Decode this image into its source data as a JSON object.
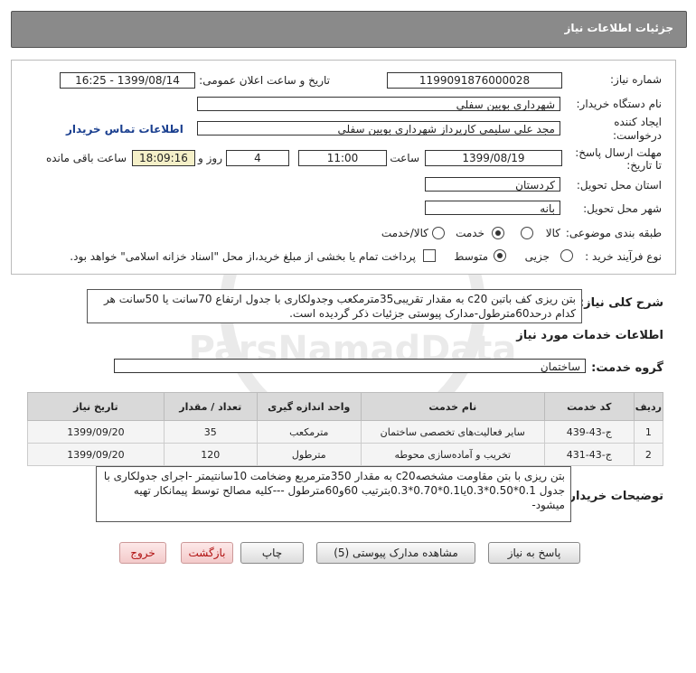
{
  "header": {
    "title": "جزئیات اطلاعات نیاز"
  },
  "fields": {
    "need_number_label": "شماره نیاز:",
    "need_number": "1199091876000028",
    "announce_label": "تاریخ و ساعت اعلان عمومی:",
    "announce_value": "1399/08/14 - 16:25",
    "buyer_org_label": "نام دستگاه خریدار:",
    "buyer_org": "شهرداری بویین سفلی",
    "creator_label_1": "ایجاد کننده",
    "creator_label_2": "درخواست:",
    "creator": "مجد علی سلیمی کارپرداز شهرداری بویین سفلی",
    "contact_link": "اطلاعات تماس خریدار",
    "deadline_label_1": "مهلت ارسال پاسخ:",
    "deadline_label_2": "تا تاریخ:",
    "deadline_date": "1399/08/19",
    "time_label": "ساعت",
    "deadline_time": "11:00",
    "days_value": "4",
    "days_label": "روز و",
    "remaining_time": "18:09:16",
    "remaining_label": "ساعت باقی مانده",
    "province_label": "استان محل تحویل:",
    "province": "کردستان",
    "city_label": "شهر محل تحویل:",
    "city": "بانه",
    "category_label": "طبقه بندی موضوعی:",
    "category_options": [
      "کالا",
      "خدمت",
      "کالا/خدمت"
    ],
    "process_label": "نوع فرآیند خرید :",
    "process_options": [
      "جزیی",
      "متوسط"
    ],
    "payment_note": "پرداخت تمام یا بخشی از مبلغ خرید،از محل \"اسناد خزانه اسلامی\" خواهد بود."
  },
  "summary": {
    "label": "شرح کلی نیاز:",
    "text": "بتن ریزی کف باتبن c20 به مقدار تقریبی35مترمکعب وجدولکاری با جدول ارتفاع 70سانت یا 50سانت هر کدام درحد60مترطول-مدارک پیوستی جزئیات ذکر گردیده است."
  },
  "services": {
    "section_title": "اطلاعات خدمات مورد نیاز",
    "group_label": "گروه خدمت:",
    "group_value": "ساختمان",
    "columns": [
      "ردیف",
      "کد خدمت",
      "نام خدمت",
      "واحد اندازه گیری",
      "تعداد / مقدار",
      "تاریخ نیاز"
    ],
    "rows": [
      [
        "1",
        "ج-43-439",
        "سایر فعالیت‌های تخصصی ساختمان",
        "مترمکعب",
        "35",
        "1399/09/20"
      ],
      [
        "2",
        "ج-43-431",
        "تخریب و آماده‌سازی محوطه",
        "مترطول",
        "120",
        "1399/09/20"
      ]
    ]
  },
  "buyer_notes": {
    "label": "توضیحات خریدار:",
    "text": "بتن ریزی با بتن مقاومت مشخصهc20 به مقدار 350مترمربع وضخامت 10سانتیمتر -اجرای جدولکاری با جدول 0.1*0.50*0.3یا0.1*0.70*0.3بترتیب 60و60مترطول ---کلیه مصالح توسط پیمانکار تهیه میشود-"
  },
  "buttons": {
    "reply": "پاسخ به نیاز",
    "docs": "مشاهده مدارک پیوستی (5)",
    "print": "چاپ",
    "back": "بازگشت",
    "exit": "خروج"
  },
  "watermark": {
    "brand": "ParsNamadData"
  }
}
